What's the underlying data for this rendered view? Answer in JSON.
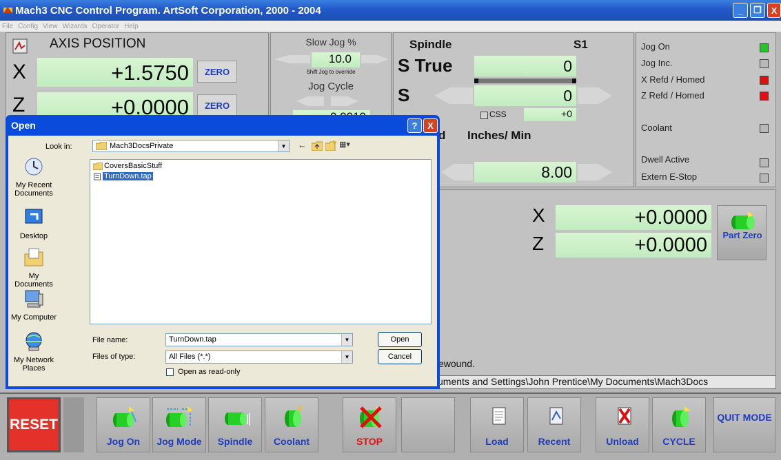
{
  "window": {
    "title": "Mach3 CNC Control Program. ArtSoft Corporation, 2000 - 2004",
    "min": "_",
    "max": "❐",
    "close": "X"
  },
  "menu": [
    "File",
    "Config",
    "View",
    "Wizards",
    "Operator",
    "Help"
  ],
  "axis": {
    "title": "AXIS POSITION",
    "x_label": "X",
    "x_value": "+1.5750",
    "z_label": "Z",
    "z_value": "+0.0000",
    "zero_label": "ZERO"
  },
  "jog": {
    "slow_label": "Slow Jog %",
    "slow_value": "10.0",
    "shift_note": "Shift Jog to override",
    "cycle_label": "Jog Cycle",
    "partial_value": "0.0010"
  },
  "spindle": {
    "title": "Spindle",
    "s1": "S1",
    "s_true_label": "S True",
    "s_true_value": "0",
    "s_label": "S",
    "s_value": "0",
    "css_label": "CSS",
    "css_value": "+0",
    "feed_label": "Inches/ Min",
    "feed_value": "8.00",
    "feed_cut": "d"
  },
  "leds": [
    {
      "label": "Jog On",
      "color": "#27c427"
    },
    {
      "label": "Jog Inc.",
      "color": "#b8b8b8"
    },
    {
      "label": "X Refd / Homed",
      "color": "#e01010"
    },
    {
      "label": "Z Refd / Homed",
      "color": "#e01010"
    },
    {
      "label": "Coolant",
      "color": "#b8b8b8"
    },
    {
      "label": "Dwell Active",
      "color": "#b8b8b8"
    },
    {
      "label": "Extern E-Stop",
      "color": "#b8b8b8"
    }
  ],
  "part": {
    "x_label": "X",
    "x_value": "+0.0000",
    "z_label": "Z",
    "z_value": "+0.0000",
    "button": "Part Zero"
  },
  "status": {
    "message": "ewound.",
    "path": "uments and Settings\\John Prentice\\My Documents\\Mach3Docs"
  },
  "buttons": {
    "reset": "RESET",
    "jog_on": "Jog On",
    "jog_mode": "Jog Mode",
    "spindle": "Spindle",
    "coolant": "Coolant",
    "stop": "STOP",
    "load": "Load",
    "recent": "Recent",
    "unload": "Unload",
    "cycle": "CYCLE",
    "quit": "QUIT MODE"
  },
  "dialog": {
    "title": "Open",
    "look_in_label": "Look in:",
    "look_in_value": "Mach3DocsPrivate",
    "places": [
      "My Recent Documents",
      "Desktop",
      "My Documents",
      "My Computer",
      "My Network Places"
    ],
    "files": [
      "CoversBasicStuff",
      "TurnDown.tap"
    ],
    "file_name_label": "File name:",
    "file_name_value": "TurnDown.tap",
    "file_type_label": "Files of type:",
    "file_type_value": "All Files (*.*)",
    "open_btn": "Open",
    "cancel_btn": "Cancel",
    "readonly_label": "Open as read-only",
    "help": "?",
    "close": "X"
  }
}
